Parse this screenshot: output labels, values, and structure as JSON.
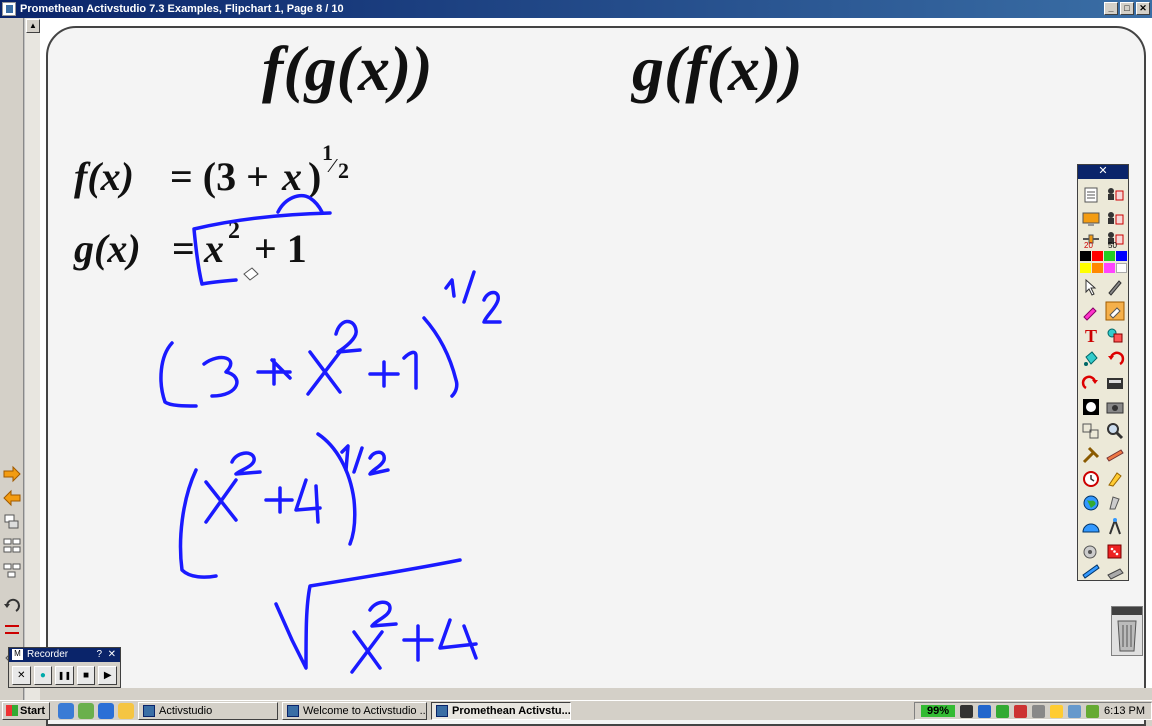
{
  "window": {
    "title": "Promethean Activstudio   7.3 Examples, Flipchart 1,  Page 8 / 10",
    "min": "_",
    "max": "□",
    "close": "✕"
  },
  "toolbox": {
    "close": "✕",
    "size_small": "20",
    "size_large": "50",
    "colors": [
      "#000000",
      "#ff0000",
      "#22cc22",
      "#0000ff",
      "#ffff00",
      "#ff8800",
      "#ff44ff",
      "#ffffff"
    ]
  },
  "recorder": {
    "m": "M",
    "title": "Recorder",
    "help": "?",
    "close": "✕",
    "buttons": [
      "✕",
      "●",
      "❚❚",
      "■",
      "▶"
    ]
  },
  "taskbar": {
    "start": "Start",
    "tasks": [
      {
        "label": "Activstudio",
        "active": false
      },
      {
        "label": "Welcome to Activstudio ...",
        "active": false
      },
      {
        "label": "Promethean Activstu...",
        "active": true
      }
    ],
    "battery": "99%",
    "clock": "6:13 PM"
  },
  "colors": {
    "ink": "#1a1aff",
    "title_bar": "#0a246a"
  }
}
